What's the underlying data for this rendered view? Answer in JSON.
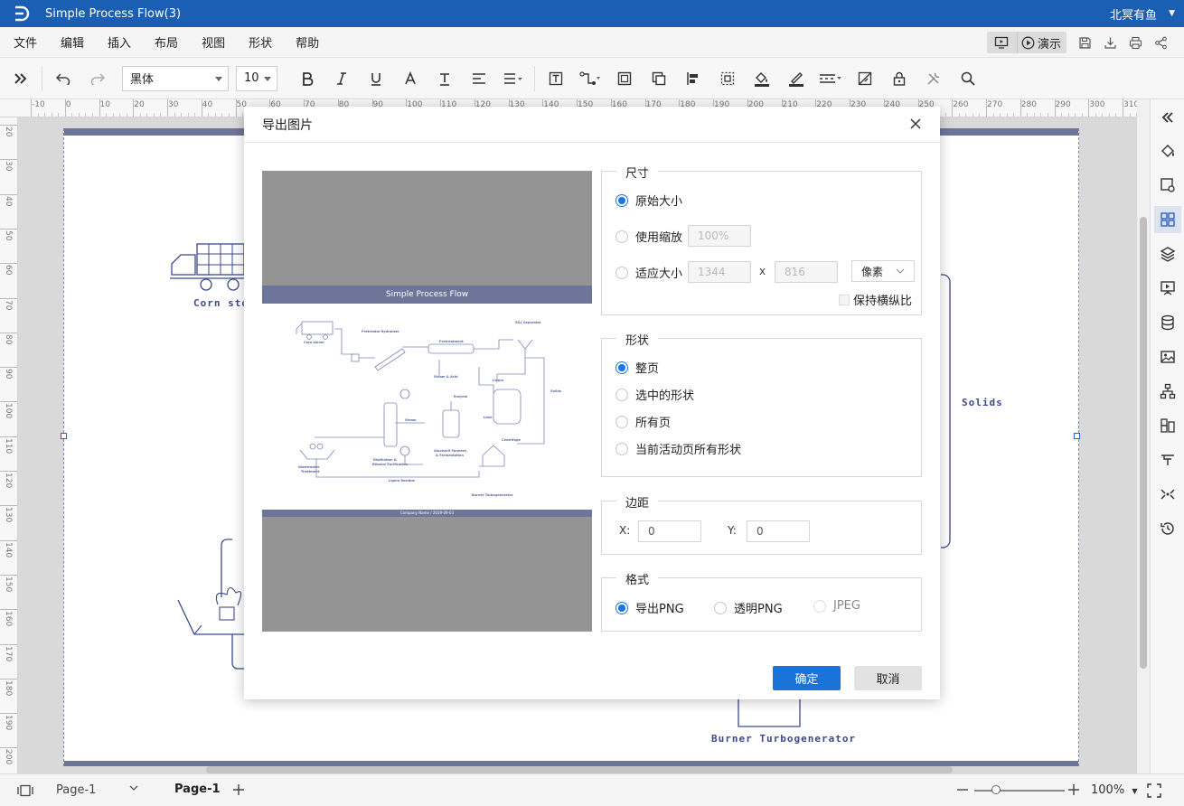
{
  "app": {
    "title": "Simple Process Flow(3)",
    "user": "北冥有鱼"
  },
  "menu": {
    "items": [
      "文件",
      "编辑",
      "插入",
      "布局",
      "视图",
      "形状",
      "帮助"
    ],
    "present_label": "演示"
  },
  "toolbar": {
    "font": "黑体",
    "font_size": "10"
  },
  "ruler": {
    "h_ticks": [
      "-10",
      "0",
      "10",
      "20",
      "30",
      "40",
      "50",
      "60",
      "70",
      "80",
      "90",
      "100",
      "110",
      "120",
      "130",
      "140",
      "150",
      "160",
      "170",
      "180",
      "190",
      "200",
      "210",
      "220",
      "230",
      "240",
      "250",
      "260",
      "270",
      "280",
      "290",
      "300",
      "310"
    ],
    "v_ticks": [
      "20",
      "30",
      "40",
      "50",
      "60",
      "70",
      "80",
      "90",
      "100",
      "110",
      "120",
      "130",
      "140",
      "150",
      "160",
      "170",
      "180",
      "190",
      "200"
    ]
  },
  "canvas": {
    "labels": {
      "corn": "Corn sto",
      "solids": "Solids",
      "burner": "Burner Turbogenerator"
    }
  },
  "dialog": {
    "title": "导出图片",
    "preview": {
      "title": "Simple Process Flow",
      "footer": "Company Name / 2019-09-03"
    },
    "size": {
      "label": "尺寸",
      "original": "原始大小",
      "scale": "使用缩放",
      "scale_value": "100%",
      "fit": "适应大小",
      "width": "1344",
      "times": "x",
      "height": "816",
      "unit": "像素",
      "keep_ratio": "保持横纵比"
    },
    "shape": {
      "label": "形状",
      "options": [
        "整页",
        "选中的形状",
        "所有页",
        "当前活动页所有形状"
      ]
    },
    "margin": {
      "label": "边距",
      "x_label": "X:",
      "x_value": "0",
      "y_label": "Y:",
      "y_value": "0"
    },
    "format": {
      "label": "格式",
      "options": [
        "导出PNG",
        "透明PNG",
        "JPEG"
      ]
    },
    "ok": "确定",
    "cancel": "取消"
  },
  "status": {
    "page_select": "Page-1",
    "page_tab": "Page-1",
    "zoom": "100%"
  }
}
